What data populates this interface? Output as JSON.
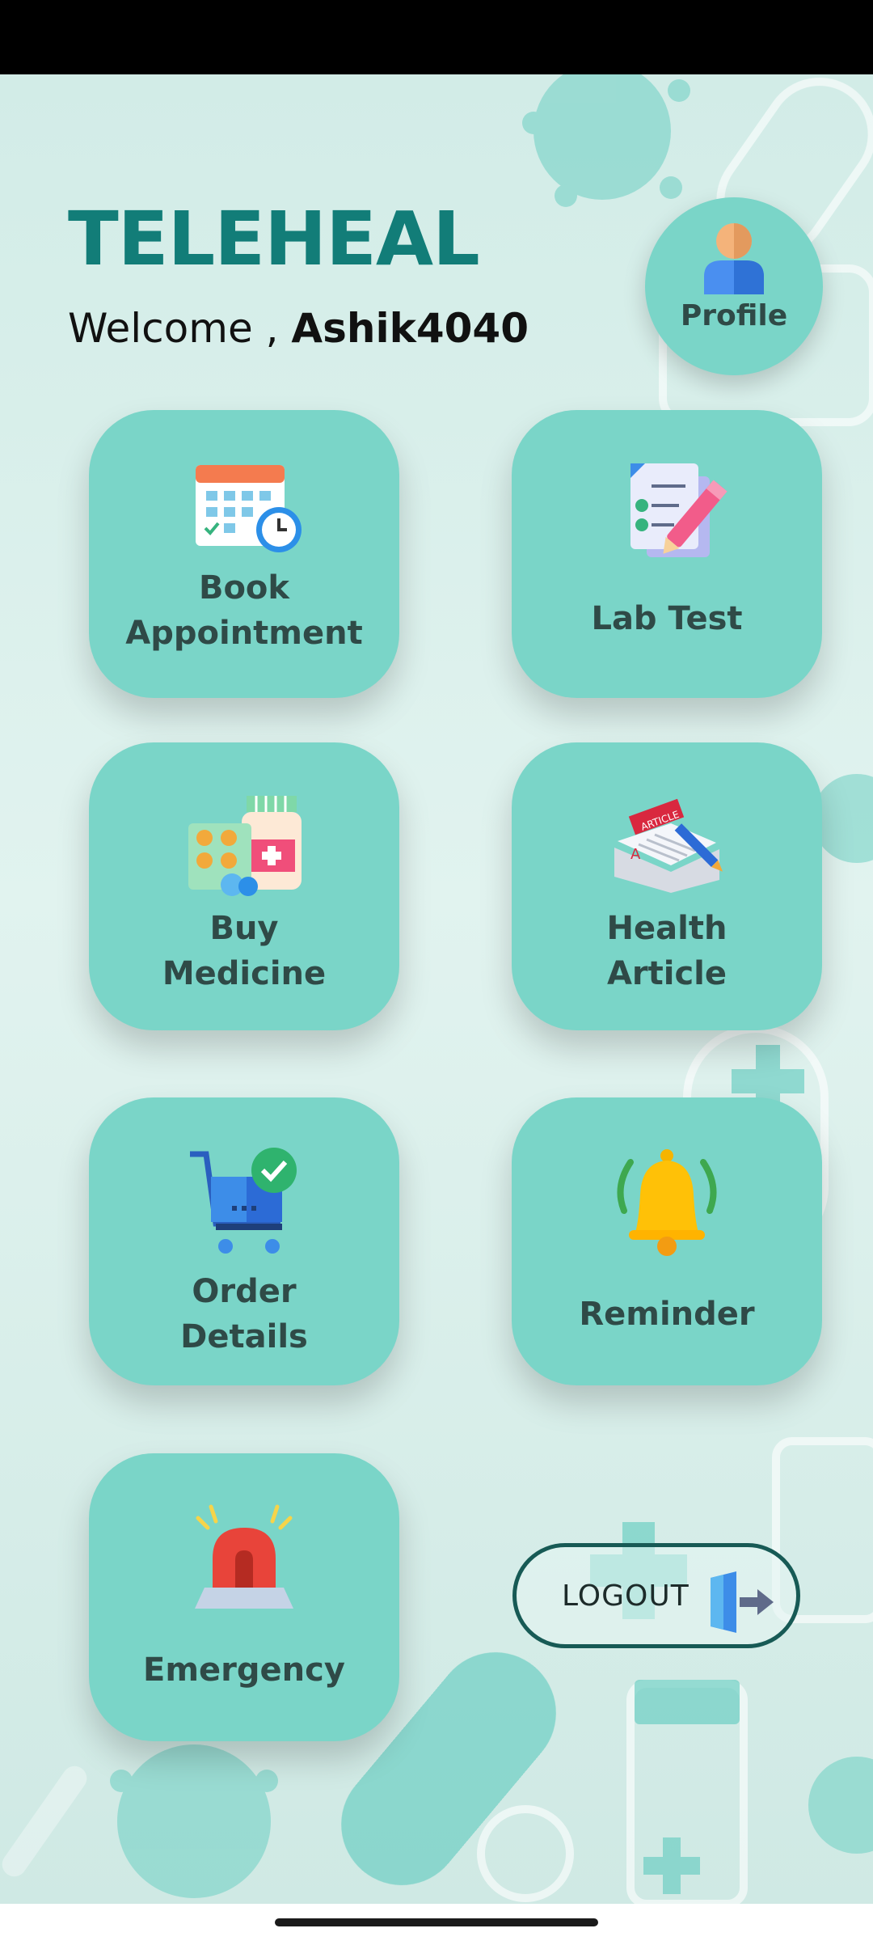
{
  "app": {
    "title": "TELEHEAL"
  },
  "header": {
    "welcome_prefix": "Welcome ,",
    "username": "Ashik4040"
  },
  "profile": {
    "label": "Profile",
    "icon": "user-avatar-icon"
  },
  "tiles": [
    {
      "line1": "Book",
      "line2": "Appointment",
      "icon": "calendar-clock-icon"
    },
    {
      "line1": "Lab Test",
      "line2": "",
      "icon": "checklist-pencil-icon"
    },
    {
      "line1": "Buy",
      "line2": "Medicine",
      "icon": "pills-bottle-icon"
    },
    {
      "line1": "Health",
      "line2": "Article",
      "icon": "article-newspaper-icon"
    },
    {
      "line1": "Order",
      "line2": "Details",
      "icon": "shopping-cart-check-icon"
    },
    {
      "line1": "Reminder",
      "line2": "",
      "icon": "bell-icon"
    },
    {
      "line1": "Emergency",
      "line2": "",
      "icon": "siren-icon"
    }
  ],
  "logout": {
    "label": "LOGOUT",
    "icon": "exit-door-icon"
  },
  "colors": {
    "brand": "#127d78",
    "tile": "#7ad5c8",
    "tile_text": "#2f4a47",
    "background": "#d2ece7"
  }
}
